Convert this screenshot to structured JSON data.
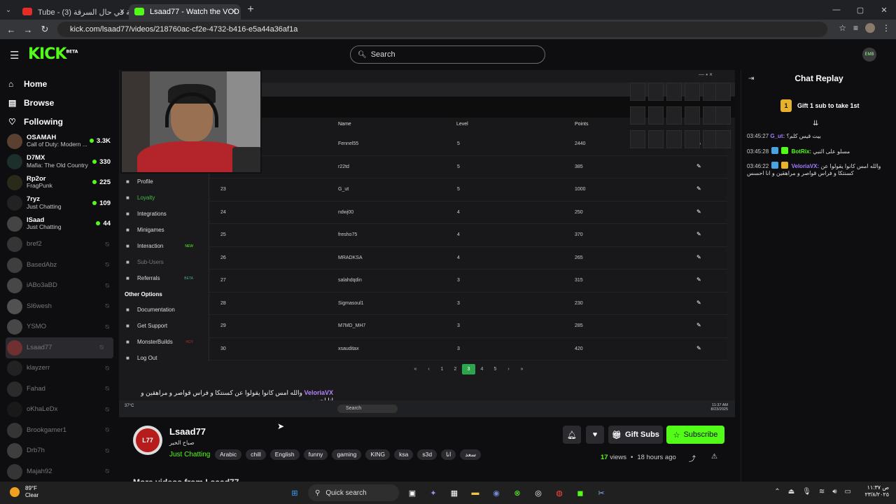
{
  "browser": {
    "tabs": [
      {
        "label": "Tube - الخطة في حال السرقة (3)",
        "active": false
      },
      {
        "label": "Lsaad77 - Watch the VOD o",
        "active": true
      }
    ],
    "url": "kick.com/lsaad77/videos/218760ac-cf2e-4732-b416-e5a44a36af1a"
  },
  "header": {
    "logo": "KICK",
    "logo_badge": "BETA",
    "search_placeholder": "Search"
  },
  "sidebar": {
    "nav": [
      {
        "label": "Home",
        "icon": "home-icon"
      },
      {
        "label": "Browse",
        "icon": "browse-icon"
      },
      {
        "label": "Following",
        "icon": "heart-icon"
      }
    ],
    "channels": [
      {
        "name": "OSAMAH",
        "game": "Call of Duty: Modern ...",
        "viewers": "3.3K",
        "live": true,
        "color": "#5a4030"
      },
      {
        "name": "D7MX",
        "game": "Mafia: The Old Country",
        "viewers": "330",
        "live": true,
        "color": "#1d2f2a"
      },
      {
        "name": "Rp2or",
        "game": "FragPunk",
        "viewers": "225",
        "live": true,
        "color": "#2a2a1a"
      },
      {
        "name": "7ryz",
        "game": "Just Chatting",
        "viewers": "109",
        "live": true,
        "color": "#222"
      },
      {
        "name": "lSaad",
        "game": "Just Chatting",
        "viewers": "44",
        "live": true,
        "color": "#444"
      },
      {
        "name": "bref2",
        "live": false,
        "color": "#555"
      },
      {
        "name": "BasedAbz",
        "live": false,
        "color": "#666"
      },
      {
        "name": "iABo3aBD",
        "live": false,
        "color": "#777"
      },
      {
        "name": "Sl6wesh",
        "live": false,
        "color": "#888"
      },
      {
        "name": "YSMO",
        "live": false,
        "color": "#777"
      },
      {
        "name": "Lsaad77",
        "live": false,
        "color": "#a33",
        "selected": true
      },
      {
        "name": "klayzerr",
        "live": false,
        "color": "#333"
      },
      {
        "name": "Fahad",
        "live": false,
        "color": "#444"
      },
      {
        "name": "oKhaLeDx",
        "live": false,
        "color": "#222"
      },
      {
        "name": "Brookgamer1",
        "live": false,
        "color": "#555"
      },
      {
        "name": "Drb7h",
        "live": false,
        "color": "#666"
      },
      {
        "name": "Majah92",
        "live": false,
        "color": "#555"
      }
    ]
  },
  "video": {
    "dashboard_menu": [
      {
        "label": "Profile",
        "icon": "user-icon"
      },
      {
        "label": "Loyalty",
        "icon": "trophy-icon",
        "active": true
      },
      {
        "label": "Integrations",
        "icon": "plug-icon"
      },
      {
        "label": "Minigames",
        "icon": "gamepad-icon"
      },
      {
        "label": "Interaction",
        "icon": "music-icon",
        "badge": "NEW"
      },
      {
        "label": "Sub-Users",
        "icon": "users-icon",
        "dim": true
      },
      {
        "label": "Referrals",
        "icon": "referral-icon",
        "badge": "BETA"
      }
    ],
    "other_options_title": "Other Options",
    "other_menu": [
      {
        "label": "Documentation",
        "icon": "doc-icon"
      },
      {
        "label": "Get Support",
        "icon": "support-icon"
      },
      {
        "label": "MonsterBuilds",
        "icon": "monitor-icon",
        "badge": "HOT"
      },
      {
        "label": "Log Out",
        "icon": "logout-icon"
      }
    ],
    "table_headers": {
      "name": "Name",
      "level": "Level",
      "points": "Points"
    },
    "rows": [
      {
        "rank": "",
        "name": "Fennel55",
        "level": "5",
        "points": "2440"
      },
      {
        "rank": "",
        "name": "r22td",
        "level": "5",
        "points": "385"
      },
      {
        "rank": "23",
        "name": "G_ut",
        "level": "5",
        "points": "1000"
      },
      {
        "rank": "24",
        "name": "ndwj00",
        "level": "4",
        "points": "250"
      },
      {
        "rank": "25",
        "name": "fresho75",
        "level": "4",
        "points": "370"
      },
      {
        "rank": "26",
        "name": "MRADKSA",
        "level": "4",
        "points": "265"
      },
      {
        "rank": "27",
        "name": "salahdqdin",
        "level": "3",
        "points": "315"
      },
      {
        "rank": "28",
        "name": "Sigmasoul1",
        "level": "3",
        "points": "230"
      },
      {
        "rank": "29",
        "name": "M7MD_MH7",
        "level": "3",
        "points": "285"
      },
      {
        "rank": "30",
        "name": "xsauditax",
        "level": "3",
        "points": "420"
      }
    ],
    "pager": [
      "«",
      "‹",
      "1",
      "2",
      "3",
      "4",
      "5",
      "›",
      "»"
    ],
    "pager_current": "3",
    "caption_user": "VeloriaVX",
    "caption_text": "والله امس كانوا يقولوا عن كسنتكا و فراس قواصر و مراهقين و انا احسس",
    "inner_taskbar": {
      "search": "Search",
      "weather": "37°C",
      "time": "11:37 AM",
      "date": "8/23/2025"
    }
  },
  "chat": {
    "title": "Chat Replay",
    "gift_num": "1",
    "gift_text": "Gift 1 sub to take 1st",
    "messages": [
      {
        "time": "03:45:27",
        "user": "G_ut:",
        "text": "بيت قيس كلم؟"
      },
      {
        "time": "03:45:28",
        "user": "BotRix:",
        "text": "مسلو على النبي"
      },
      {
        "time": "03:46:22",
        "user": "VeloriaVX:",
        "text": "والله امس كانوا يقولوا عن كسنتكا و فراس قواصر و مراهقين و انا احسس"
      }
    ]
  },
  "channel": {
    "name": "Lsaad77",
    "subtitle": "صباح الخير",
    "category": "Just Chatting",
    "tags": [
      "Arabic",
      "chill",
      "English",
      "funny",
      "gaming",
      "KING",
      "ksa",
      "s3d",
      "انا",
      "سعد"
    ],
    "gift_label": "Gift Subs",
    "subscribe_label": "Subscribe",
    "views_num": "17",
    "views_label": "views",
    "ago": "18 hours ago",
    "more_videos": "More videos from Lsaad77"
  },
  "taskbar": {
    "temp": "89°F",
    "condition": "Clear",
    "search": "Quick search",
    "time": "ص ١١:٣٧",
    "date": "٢٣/٨/٢٠٢٥"
  }
}
